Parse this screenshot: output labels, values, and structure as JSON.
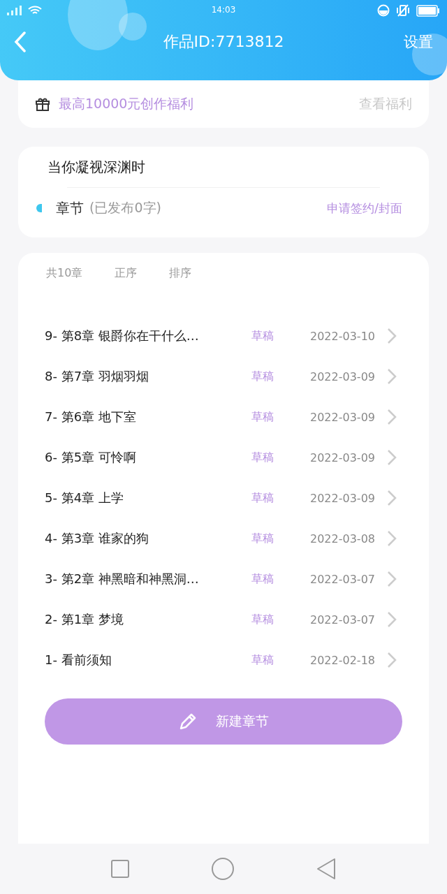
{
  "status_bar": {
    "time": "14:03"
  },
  "header": {
    "title": "作品ID:7713812",
    "settings": "设置"
  },
  "benefit": {
    "text": "最高10000元创作福利",
    "link": "查看福利"
  },
  "work": {
    "title": "当你凝视深渊时",
    "section": "章节",
    "published": "(已发布0字)",
    "link": "申请签约/封面"
  },
  "chapters_header": {
    "count": "共10章",
    "order": "正序",
    "sort": "排序"
  },
  "chapters": [
    {
      "title": "9- 第8章 银爵你在干什么…",
      "status": "草稿",
      "date": "2022-03-10"
    },
    {
      "title": "8- 第7章 羽烟羽烟",
      "status": "草稿",
      "date": "2022-03-09"
    },
    {
      "title": "7- 第6章 地下室",
      "status": "草稿",
      "date": "2022-03-09"
    },
    {
      "title": "6- 第5章 可怜啊",
      "status": "草稿",
      "date": "2022-03-09"
    },
    {
      "title": "5- 第4章 上学",
      "status": "草稿",
      "date": "2022-03-09"
    },
    {
      "title": "4- 第3章 谁家的狗",
      "status": "草稿",
      "date": "2022-03-08"
    },
    {
      "title": "3- 第2章 神黑暗和神黑洞…",
      "status": "草稿",
      "date": "2022-03-07"
    },
    {
      "title": "2- 第1章 梦境",
      "status": "草稿",
      "date": "2022-03-07"
    },
    {
      "title": "1- 看前须知",
      "status": "草稿",
      "date": "2022-02-18"
    }
  ],
  "new_chapter_button": "新建章节"
}
